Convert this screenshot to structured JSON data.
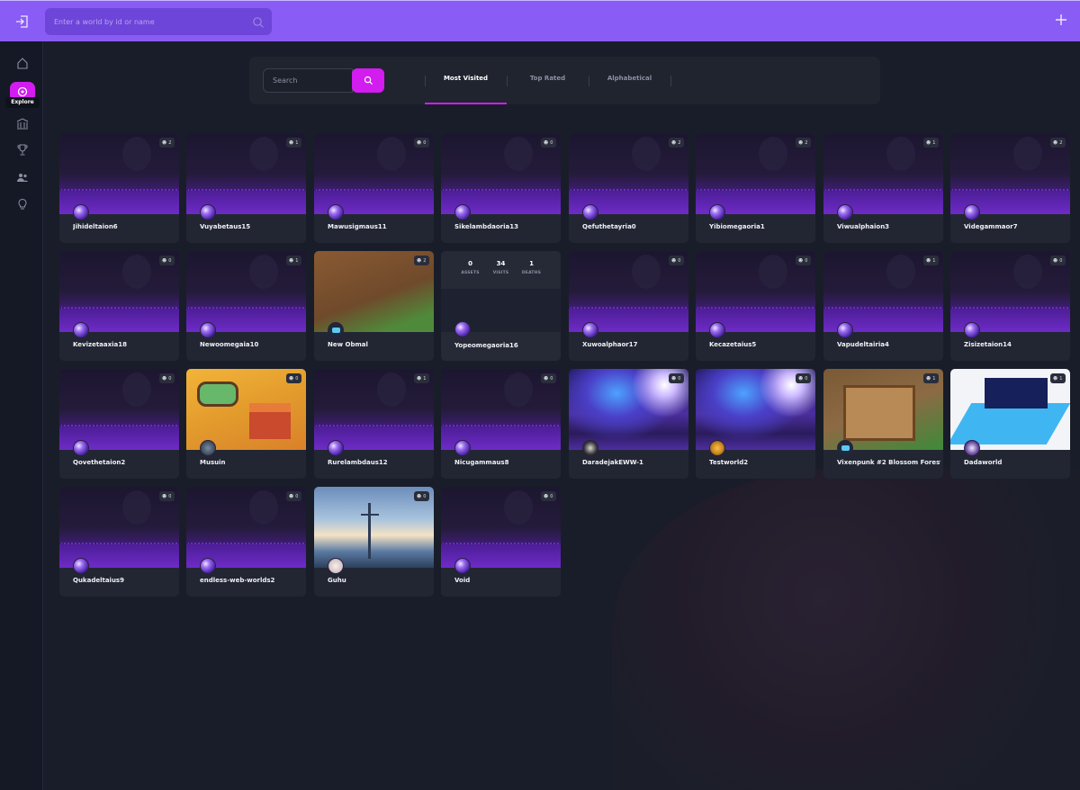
{
  "topbar": {
    "world_search_placeholder": "Enter a world by id or name",
    "login_icon": "login-icon",
    "plus_icon": "plus-icon",
    "accent": "#8a5cf6"
  },
  "sidebar": {
    "active_label": "Explore",
    "items": [
      {
        "icon": "home-icon"
      },
      {
        "icon": "explore-icon"
      },
      {
        "icon": "bank-icon"
      },
      {
        "icon": "trophy-icon"
      },
      {
        "icon": "users-icon"
      },
      {
        "icon": "lightbulb-icon"
      }
    ],
    "active_color": "#d21cf0"
  },
  "filter": {
    "search_placeholder": "Search",
    "tabs": [
      {
        "label": "Most Visited",
        "active": true
      },
      {
        "label": "Top Rated",
        "active": false
      },
      {
        "label": "Alphabetical",
        "active": false
      }
    ]
  },
  "worlds": [
    {
      "name": "Jihideltaion6",
      "badge": "2",
      "thumb": "default",
      "avatar": "orb"
    },
    {
      "name": "Vuyabetaus15",
      "badge": "1",
      "thumb": "default",
      "avatar": "orb"
    },
    {
      "name": "Mawusigmaus11",
      "badge": "0",
      "thumb": "default",
      "avatar": "orb"
    },
    {
      "name": "Sikelambdaoria13",
      "badge": "0",
      "thumb": "default",
      "avatar": "orb"
    },
    {
      "name": "Qefuthetayria0",
      "badge": "2",
      "thumb": "default",
      "avatar": "orb"
    },
    {
      "name": "Yibiomegaoria1",
      "badge": "2",
      "thumb": "default",
      "avatar": "orb"
    },
    {
      "name": "Viwualphaion3",
      "badge": "1",
      "thumb": "default",
      "avatar": "orb"
    },
    {
      "name": "Videgammaor7",
      "badge": "2",
      "thumb": "default",
      "avatar": "orb"
    },
    {
      "name": "Kevizetaaxia18",
      "badge": "0",
      "thumb": "default",
      "avatar": "orb"
    },
    {
      "name": "Newoomegaia10",
      "badge": "1",
      "thumb": "default",
      "avatar": "orb"
    },
    {
      "name": "New Obmal",
      "badge": "2",
      "thumb": "saloon",
      "avatar": "cat"
    },
    {
      "name": "Yopeomegaoria16",
      "badge": "",
      "thumb": "stats",
      "avatar": "orb",
      "stats": [
        {
          "value": "0",
          "label": "ASSETS"
        },
        {
          "value": "34",
          "label": "VISITS"
        },
        {
          "value": "1",
          "label": "DEATHS"
        }
      ]
    },
    {
      "name": "Xuwoalphaor17",
      "badge": "0",
      "thumb": "default",
      "avatar": "orb"
    },
    {
      "name": "Kecazetaius5",
      "badge": "0",
      "thumb": "default",
      "avatar": "orb"
    },
    {
      "name": "Vapudeltairia4",
      "badge": "1",
      "thumb": "default",
      "avatar": "orb"
    },
    {
      "name": "Zisizetaion14",
      "badge": "0",
      "thumb": "default",
      "avatar": "orb"
    },
    {
      "name": "Qovethetaion2",
      "badge": "0",
      "thumb": "default",
      "avatar": "orb"
    },
    {
      "name": "Musuin",
      "badge": "0",
      "thumb": "farm",
      "avatar": "grey"
    },
    {
      "name": "Rurelambdaus12",
      "badge": "1",
      "thumb": "default",
      "avatar": "orb"
    },
    {
      "name": "Nicugammaus8",
      "badge": "0",
      "thumb": "default",
      "avatar": "orb"
    },
    {
      "name": "DaradejakEWW-1",
      "badge": "0",
      "thumb": "galaxy",
      "avatar": "dark"
    },
    {
      "name": "Testworld2",
      "badge": "0",
      "thumb": "galaxy",
      "avatar": "gold"
    },
    {
      "name": "Vixenpunk #2 Blossom Forest",
      "badge": "1",
      "thumb": "pixelroom",
      "avatar": "cat"
    },
    {
      "name": "Dadaworld",
      "badge": "1",
      "thumb": "iso",
      "avatar": "witch"
    },
    {
      "name": "Qukadeltaius9",
      "badge": "0",
      "thumb": "default",
      "avatar": "orb"
    },
    {
      "name": "endless-web-worlds2",
      "badge": "0",
      "thumb": "default",
      "avatar": "orb"
    },
    {
      "name": "Guhu",
      "badge": "0",
      "thumb": "photo",
      "avatar": "light"
    },
    {
      "name": "Void",
      "badge": "0",
      "thumb": "default",
      "avatar": "orb"
    }
  ]
}
